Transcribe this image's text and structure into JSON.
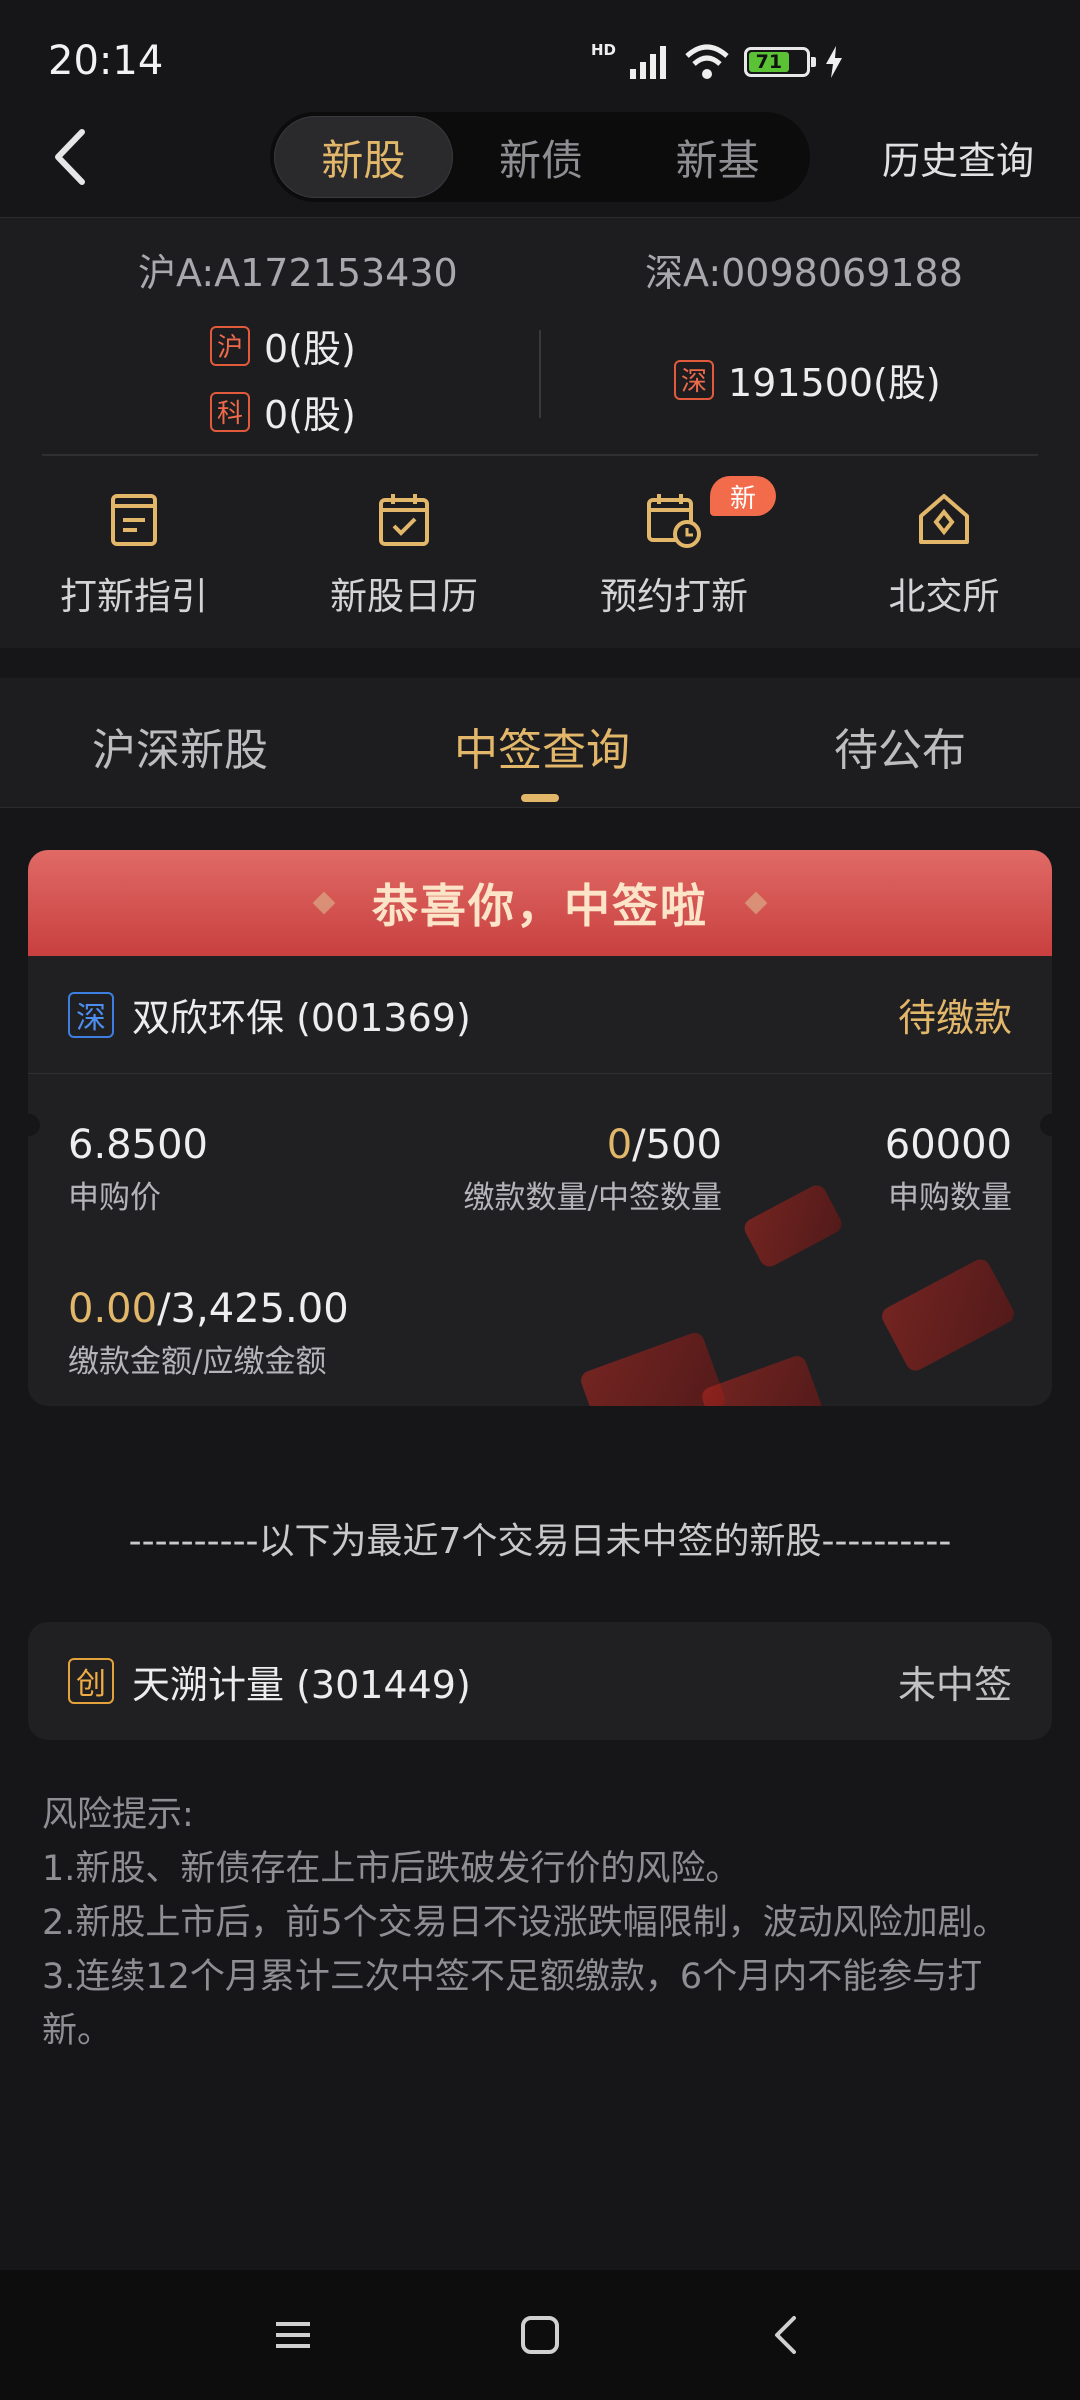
{
  "status_bar": {
    "time": "20:14",
    "network": "HD",
    "battery_level": "71",
    "icons": [
      "signal-icon",
      "wifi-icon",
      "battery-icon",
      "charging-icon"
    ]
  },
  "header": {
    "segments": [
      {
        "label": "新股",
        "active": true
      },
      {
        "label": "新债",
        "active": false
      },
      {
        "label": "新基",
        "active": false
      }
    ],
    "history_label": "历史查询"
  },
  "accounts": {
    "sh_account": "沪A:A172153430",
    "sz_account": "深A:0098069188",
    "sh_tag": "沪",
    "kc_tag": "科",
    "sz_tag": "深",
    "sh_holding": "0(股)",
    "kc_holding": "0(股)",
    "sz_holding": "191500(股)"
  },
  "tools": [
    {
      "label": "打新指引",
      "icon": "guide-icon"
    },
    {
      "label": "新股日历",
      "icon": "calendar-check-icon"
    },
    {
      "label": "预约打新",
      "icon": "calendar-clock-icon",
      "badge": "新"
    },
    {
      "label": "北交所",
      "icon": "exchange-house-icon"
    }
  ],
  "tabs": [
    {
      "label": "沪深新股",
      "active": false
    },
    {
      "label": "中签查询",
      "active": true
    },
    {
      "label": "待公布",
      "active": false
    }
  ],
  "winning": {
    "banner": "恭喜你，中签啦",
    "market_tag": "深",
    "stock": "双欣环保 (001369)",
    "status": "待缴款",
    "price": "6.8500",
    "price_label": "申购价",
    "paid_qty": "0",
    "won_qty": "/500",
    "qty_label": "缴款数量/中签数量",
    "apply_qty": "60000",
    "apply_label": "申购数量",
    "paid_amount": "0.00",
    "due_amount": "/3,425.00",
    "amount_label": "缴款金额/应缴金额"
  },
  "divider_text": "----------以下为最近7个交易日未中签的新股----------",
  "not_won": {
    "market_tag": "创",
    "stock": "天溯计量 (301449)",
    "status": "未中签"
  },
  "risk": {
    "title": "风险提示:",
    "items": [
      "1.新股、新债存在上市后跌破发行价的风险。",
      "2.新股上市后，前5个交易日不设涨跌幅限制，波动风险加剧。",
      "3.连续12个月累计三次中签不足额缴款，6个月内不能参与打新。"
    ]
  },
  "colors": {
    "accent": "#e3b76a",
    "background": "#161618",
    "panel": "#1d1d20",
    "banner_red": "#c8403f",
    "tag_red": "#e25a3c",
    "tag_blue": "#3c7fe0"
  }
}
